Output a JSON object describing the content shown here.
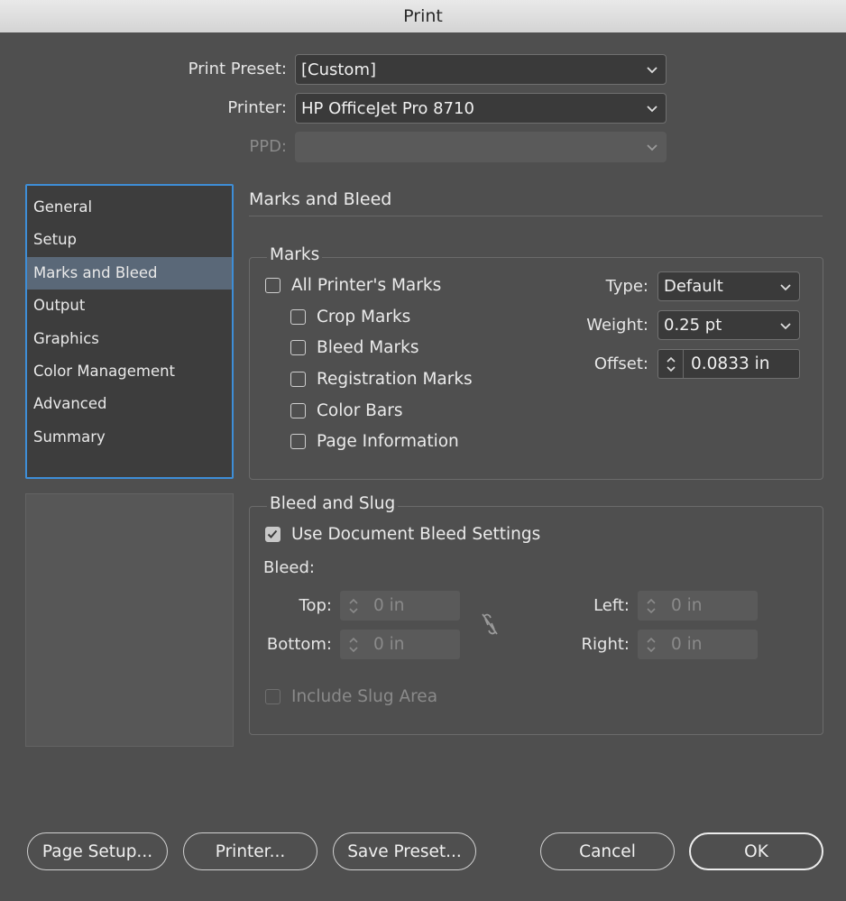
{
  "window": {
    "title": "Print"
  },
  "top": {
    "preset_label": "Print Preset:",
    "preset_value": "[Custom]",
    "printer_label": "Printer:",
    "printer_value": "HP OfficeJet Pro 8710",
    "ppd_label": "PPD:",
    "ppd_value": ""
  },
  "sidebar": {
    "items": [
      "General",
      "Setup",
      "Marks and Bleed",
      "Output",
      "Graphics",
      "Color Management",
      "Advanced",
      "Summary"
    ],
    "selected": "Marks and Bleed"
  },
  "panel": {
    "title": "Marks and Bleed"
  },
  "marks": {
    "title": "Marks",
    "all_printers_marks": {
      "label": "All Printer's Marks",
      "checked": false
    },
    "crop_marks": {
      "label": "Crop Marks",
      "checked": false
    },
    "bleed_marks": {
      "label": "Bleed Marks",
      "checked": false
    },
    "registration_marks": {
      "label": "Registration Marks",
      "checked": false
    },
    "color_bars": {
      "label": "Color Bars",
      "checked": false
    },
    "page_information": {
      "label": "Page Information",
      "checked": false
    },
    "type_label": "Type:",
    "type_value": "Default",
    "weight_label": "Weight:",
    "weight_value": "0.25 pt",
    "offset_label": "Offset:",
    "offset_value": "0.0833 in"
  },
  "bleed_slug": {
    "title": "Bleed and Slug",
    "use_document_bleed": {
      "label": "Use Document Bleed Settings",
      "checked": true
    },
    "bleed_label": "Bleed:",
    "top_label": "Top:",
    "top_value": "0 in",
    "bottom_label": "Bottom:",
    "bottom_value": "0 in",
    "left_label": "Left:",
    "left_value": "0 in",
    "right_label": "Right:",
    "right_value": "0 in",
    "include_slug": {
      "label": "Include Slug Area",
      "checked": false
    }
  },
  "buttons": {
    "page_setup": "Page Setup...",
    "printer": "Printer...",
    "save_preset": "Save Preset...",
    "cancel": "Cancel",
    "ok": "OK"
  },
  "icons": {
    "dropdown": "chevron-down-icon",
    "stepper": "up-down-arrows-icon",
    "link": "broken-link-icon",
    "check": "checkmark-icon"
  }
}
